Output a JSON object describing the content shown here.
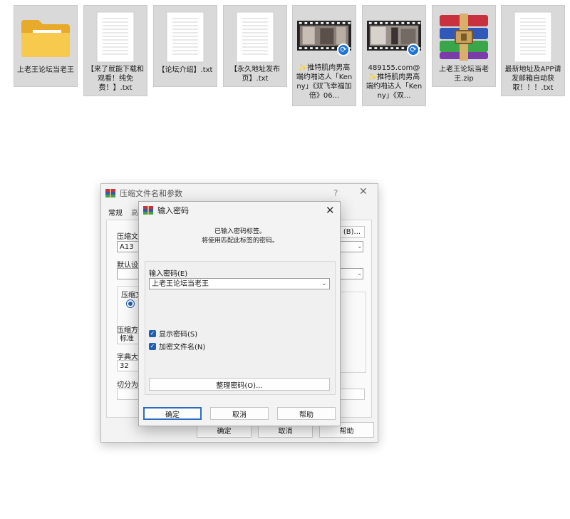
{
  "files": [
    {
      "name": "上老王论坛当老王",
      "kind": "folder"
    },
    {
      "name": "【来了就能下载和观看！纯免费！】.txt",
      "kind": "txt"
    },
    {
      "name": "【论坛介绍】.txt",
      "kind": "txt"
    },
    {
      "name": "【永久地址发布页】.txt",
      "kind": "txt"
    },
    {
      "name": "✨推特肌肉男高端约啪达人「Kenny」《双飞幸福加倍》06...",
      "kind": "video"
    },
    {
      "name": "489155.com@✨推特肌肉男高端约啪达人「Kenny」《双...",
      "kind": "video"
    },
    {
      "name": "上老王论坛当老王.zip",
      "kind": "zip"
    },
    {
      "name": "最新地址及APP请发邮箱自动获取！！！.txt",
      "kind": "txt"
    }
  ],
  "back_dialog": {
    "title": "压缩文件名和参数",
    "help_glyph": "?",
    "close_glyph": "✕",
    "tabs": [
      "常规",
      "高"
    ],
    "archive_name_label": "压缩文",
    "archive_name_value": "A13",
    "browse_label": "(B)...",
    "default_settings_label": "默认设",
    "format_label": "压缩文",
    "method_label": "压缩方",
    "method_value": "标准",
    "dict_label": "字典大",
    "dict_value": "32",
    "split_label": "切分为",
    "ok": "确定",
    "cancel": "取消",
    "help": "帮助"
  },
  "password_dialog": {
    "title": "输入密码",
    "close_glyph": "✕",
    "info_line1": "已输入密码标签。",
    "info_line2": "将使用匹配此标签的密码。",
    "password_label": "输入密码(E)",
    "password_value": "上老王论坛当老王",
    "show_password_label": "显示密码(S)",
    "show_password_checked": true,
    "encrypt_names_label": "加密文件名(N)",
    "encrypt_names_checked": true,
    "manage_button": "整理密码(O)...",
    "ok": "确定",
    "cancel": "取消",
    "help": "帮助"
  },
  "colors": {
    "tile_bg": "#d9d9d9",
    "folder_yellow": "#f5c445",
    "checkbox_blue": "#1f5fb4",
    "accent_border": "#2d6cc0"
  }
}
